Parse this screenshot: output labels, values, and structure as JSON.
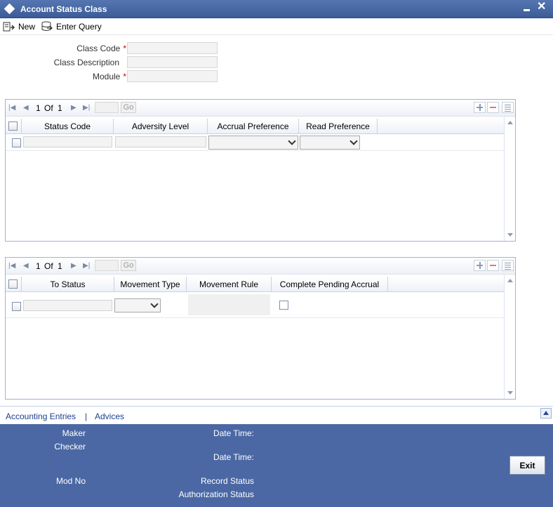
{
  "window": {
    "title": "Account Status Class",
    "minimize_icon": "minimize-icon",
    "close_glyph": "✕"
  },
  "toolbar": {
    "new_label": "New",
    "enter_query_label": "Enter Query"
  },
  "form": {
    "class_code_label": "Class Code",
    "class_description_label": "Class Description",
    "module_label": "Module",
    "required_marker": "*",
    "class_code_value": "",
    "class_description_value": "",
    "module_value": ""
  },
  "grid1": {
    "page_current": "1",
    "page_of": "Of",
    "page_total": "1",
    "go_label": "Go",
    "columns": [
      "Status Code",
      "Adversity Level",
      "Accrual Preference",
      "Read Preference"
    ]
  },
  "grid2": {
    "page_current": "1",
    "page_of": "Of",
    "page_total": "1",
    "go_label": "Go",
    "columns": [
      "To Status",
      "Movement Type",
      "Movement Rule",
      "Complete Pending Accrual"
    ]
  },
  "links": {
    "accounting_entries": "Accounting Entries",
    "separator": "|",
    "advices": "Advices"
  },
  "footer": {
    "maker_label": "Maker",
    "checker_label": "Checker",
    "date_time_label": "Date Time:",
    "mod_no_label": "Mod No",
    "record_status_label": "Record Status",
    "authorization_status_label": "Authorization Status",
    "exit_label": "Exit"
  },
  "colors": {
    "title_bar": "#3b5c98",
    "footer": "#4b68a4",
    "link": "#1c3f8f",
    "required": "#cc0000"
  }
}
